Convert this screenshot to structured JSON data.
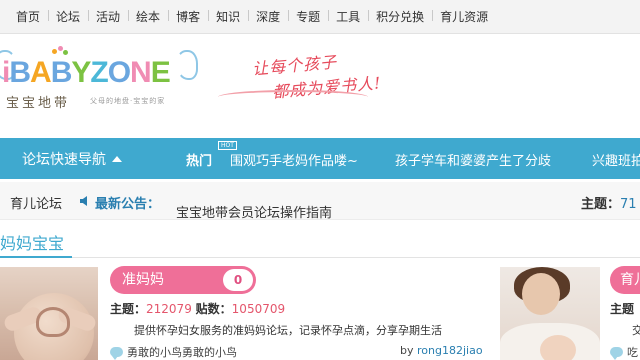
{
  "topnav": {
    "items": [
      "首页",
      "论坛",
      "活动",
      "绘本",
      "博客",
      "知识",
      "深度",
      "专题",
      "工具",
      "积分兑换",
      "育儿资源"
    ]
  },
  "logo": {
    "wordmark": "iBABYZONE",
    "cn_name": "宝宝地带",
    "cn_tagline": "父母的地盘·宝宝的家",
    "slogan_line1": "让每个孩子",
    "slogan_line2": "都成为爱书人!"
  },
  "bluebar": {
    "quicknav_label": "论坛快速导航",
    "hot_label": "热门",
    "hot_badge": "HOT",
    "links": [
      "围观巧手老妈作品喽~",
      "孩子学车和婆婆产生了分歧",
      "兴趣班拍"
    ]
  },
  "announcement": {
    "forum_label": "育儿论坛",
    "title": "最新公告：",
    "text": "宝宝地带会员论坛操作指南",
    "stat_label": "主题：",
    "stat_value": "71"
  },
  "section": {
    "title": "妈妈宝宝"
  },
  "forums": [
    {
      "name": "准妈妈",
      "today_count": "0",
      "topics_label": "主题：",
      "topics": "212079",
      "posts_label": "贴数：",
      "posts": "1050709",
      "description": "提供怀孕妇女服务的准妈妈论坛，记录怀孕点滴，分享孕期生活",
      "last_post": "勇敢的小鸟勇敢的小鸟",
      "by_label": "by",
      "by_user": "rong182jiao"
    },
    {
      "name": "育儿",
      "topics_label": "主题",
      "description": "交",
      "last_post": "吃"
    }
  ],
  "colors": {
    "brand_blue": "#3fa9cf",
    "pink": "#ef6f98",
    "link_blue": "#2a7fb0"
  }
}
